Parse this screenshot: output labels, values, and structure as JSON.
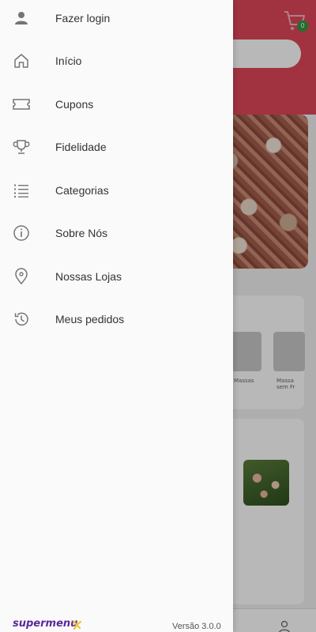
{
  "drawer": {
    "items": [
      {
        "label": "Fazer login",
        "icon": "user-icon"
      },
      {
        "label": "Início",
        "icon": "home-icon"
      },
      {
        "label": "Cupons",
        "icon": "ticket-icon"
      },
      {
        "label": "Fidelidade",
        "icon": "trophy-icon"
      },
      {
        "label": "Categorias",
        "icon": "list-icon"
      },
      {
        "label": "Sobre Nós",
        "icon": "info-icon"
      },
      {
        "label": "Nossas Lojas",
        "icon": "location-pin-icon"
      },
      {
        "label": "Meus pedidos",
        "icon": "history-icon"
      }
    ],
    "footer": {
      "brand": "supermenu",
      "version": "Versão 3.0.0"
    }
  },
  "background": {
    "cart_count": "0",
    "categories": [
      {
        "label": "Massas"
      },
      {
        "label": "Massa sem Fr"
      }
    ]
  },
  "colors": {
    "header": "#e0475a",
    "brand": "#5b2a9a",
    "badge": "#2e9b3c"
  }
}
